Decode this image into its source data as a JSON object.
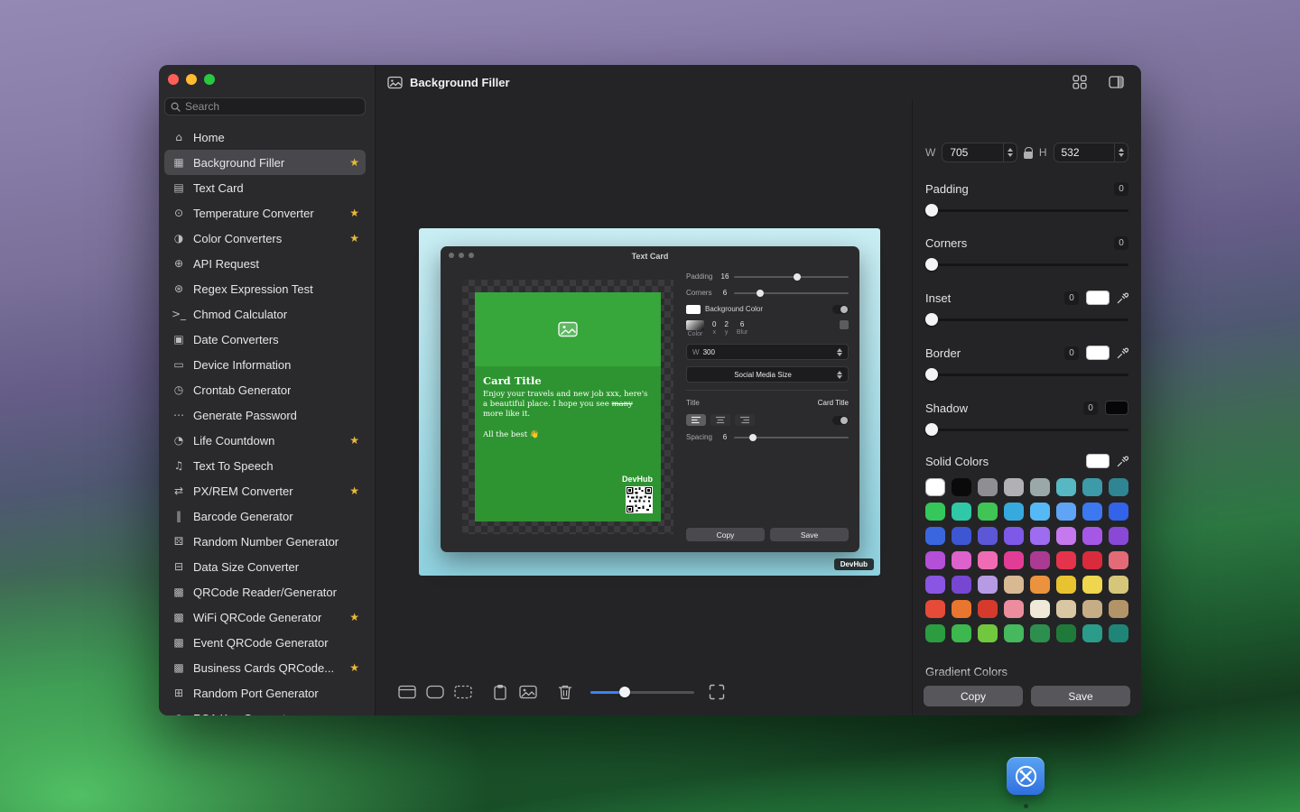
{
  "colors": {
    "accent_blue": "#3a82f7",
    "star_gold": "#e8b93c",
    "card_green": "#2e9431",
    "preview_gradient_top": "#c9eef4",
    "preview_gradient_bottom": "#8fd2e0"
  },
  "sidebar": {
    "search_placeholder": "Search",
    "items": [
      {
        "label": "Home",
        "icon": "home",
        "starred": false,
        "selected": false
      },
      {
        "label": "Background Filler",
        "icon": "photo",
        "starred": true,
        "selected": true
      },
      {
        "label": "Text Card",
        "icon": "text-card",
        "starred": false,
        "selected": false
      },
      {
        "label": "Temperature Converter",
        "icon": "thermometer",
        "starred": true,
        "selected": false
      },
      {
        "label": "Color Converters",
        "icon": "palette",
        "starred": true,
        "selected": false
      },
      {
        "label": "API Request",
        "icon": "network",
        "starred": false,
        "selected": false
      },
      {
        "label": "Regex Expression Test",
        "icon": "regex",
        "starred": false,
        "selected": false
      },
      {
        "label": "Chmod Calculator",
        "icon": "terminal",
        "starred": false,
        "selected": false
      },
      {
        "label": "Date Converters",
        "icon": "calendar",
        "starred": false,
        "selected": false
      },
      {
        "label": "Device Information",
        "icon": "device",
        "starred": false,
        "selected": false
      },
      {
        "label": "Crontab Generator",
        "icon": "clock",
        "starred": false,
        "selected": false
      },
      {
        "label": "Generate Password",
        "icon": "password",
        "starred": false,
        "selected": false
      },
      {
        "label": "Life Countdown",
        "icon": "countdown",
        "starred": true,
        "selected": false
      },
      {
        "label": "Text To Speech",
        "icon": "speech",
        "starred": false,
        "selected": false
      },
      {
        "label": "PX/REM Converter",
        "icon": "convert",
        "starred": true,
        "selected": false
      },
      {
        "label": "Barcode Generator",
        "icon": "barcode",
        "starred": false,
        "selected": false
      },
      {
        "label": "Random Number Generator",
        "icon": "dice",
        "starred": false,
        "selected": false
      },
      {
        "label": "Data Size Converter",
        "icon": "data",
        "starred": false,
        "selected": false
      },
      {
        "label": "QRCode Reader/Generator",
        "icon": "qrcode",
        "starred": false,
        "selected": false
      },
      {
        "label": "WiFi QRCode Generator",
        "icon": "qrcode",
        "starred": true,
        "selected": false
      },
      {
        "label": "Event QRCode Generator",
        "icon": "qrcode",
        "starred": false,
        "selected": false
      },
      {
        "label": "Business Cards QRCode...",
        "icon": "qrcode",
        "starred": true,
        "selected": false
      },
      {
        "label": "Random Port Generator",
        "icon": "port",
        "starred": false,
        "selected": false
      },
      {
        "label": "RSA Key Generator",
        "icon": "key",
        "starred": false,
        "selected": false
      }
    ]
  },
  "header": {
    "title": "Background Filler",
    "titlebar_icons": [
      "grid-view-icon",
      "toggle-inspector-icon"
    ]
  },
  "toolbar": {
    "icons": [
      "frame-window",
      "frame-rounded",
      "frame-dashed",
      "paste",
      "insert-image",
      "trash",
      "zoom-slider",
      "fit-view"
    ]
  },
  "preview": {
    "watermark": "DevHub"
  },
  "mock": {
    "title": "Text Card",
    "card": {
      "title": "Card Title",
      "body_before": "Enjoy your travels and new job xxx, here's a beautiful place. I hope you see ",
      "body_strike": "many",
      "body_after": " more like it.",
      "closing": "All the best 👋",
      "brand": "DevHub"
    },
    "controls": {
      "padding_label": "Padding",
      "padding_value": "16",
      "corners_label": "Corners",
      "corners_value": "6",
      "background_color_label": "Background Color",
      "shadow_color_label": "Color",
      "shadow_x_value": "0",
      "shadow_x_label": "x",
      "shadow_y_value": "2",
      "shadow_y_label": "y",
      "shadow_blur_value": "6",
      "shadow_blur_label": "Blur",
      "width_label": "W",
      "width_value": "300",
      "size_preset": "Social Media Size",
      "title_label": "Title",
      "title_value": "Card Title",
      "spacing_label": "Spacing",
      "spacing_value": "6",
      "copy_label": "Copy",
      "save_label": "Save"
    }
  },
  "inspector": {
    "size": {
      "w_label": "W",
      "w_value": "705",
      "h_label": "H",
      "h_value": "532"
    },
    "padding": {
      "label": "Padding",
      "value": "0"
    },
    "corners": {
      "label": "Corners",
      "value": "0"
    },
    "inset": {
      "label": "Inset",
      "value": "0",
      "swatch": "#ffffff"
    },
    "border": {
      "label": "Border",
      "value": "0",
      "swatch": "#ffffff"
    },
    "shadow": {
      "label": "Shadow",
      "value": "0",
      "swatch": "#000000"
    },
    "solid_colors_label": "Solid Colors",
    "gradient_colors_label": "Gradient Colors",
    "solid_colors": [
      "#ffffff",
      "#0a0a0a",
      "#8e8e93",
      "#b0b0b5",
      "#9aa8a8",
      "#57b7c2",
      "#3d9aa8",
      "#2f8593",
      "#35c759",
      "#2fc9a7",
      "#3fc455",
      "#36aadf",
      "#55b9f5",
      "#5fa4f5",
      "#3c78f0",
      "#3263e8",
      "#3a66e0",
      "#3e55d4",
      "#5b57d6",
      "#7e58e8",
      "#9d6cf0",
      "#c678ee",
      "#a557e6",
      "#8948d6",
      "#b44fd8",
      "#dd62cc",
      "#ef6cb5",
      "#e23d96",
      "#aa3a92",
      "#e6334c",
      "#d92b3c",
      "#e26b77",
      "#8a55e2",
      "#7747d2",
      "#b79ae4",
      "#d9b993",
      "#ea923e",
      "#e8c32f",
      "#eed64e",
      "#d6c67a",
      "#e64a38",
      "#e8762e",
      "#d63a2c",
      "#ec8d9d",
      "#f0e9d8",
      "#d9c7a4",
      "#c7ad85",
      "#b39468",
      "#2b9c3f",
      "#3cb84e",
      "#71c83e",
      "#46b85e",
      "#2d8f4e",
      "#1f7a3a",
      "#2b9b8a",
      "#1e8577"
    ],
    "gradient_colors": [
      [
        "#f0b152",
        "#e2703a"
      ],
      [
        "#f4c9a6",
        "#eb9878"
      ],
      [
        "#f3a8bc",
        "#e877a6"
      ],
      [
        "#ef84b4",
        "#da5897"
      ],
      [
        "#e693a9",
        "#c76189"
      ],
      [
        "#b383dc",
        "#8b5ac4"
      ],
      [
        "#a273e2",
        "#7b4ccb"
      ],
      [
        "#9263d4",
        "#6a3cb4"
      ]
    ],
    "copy_label": "Copy",
    "save_label": "Save"
  }
}
